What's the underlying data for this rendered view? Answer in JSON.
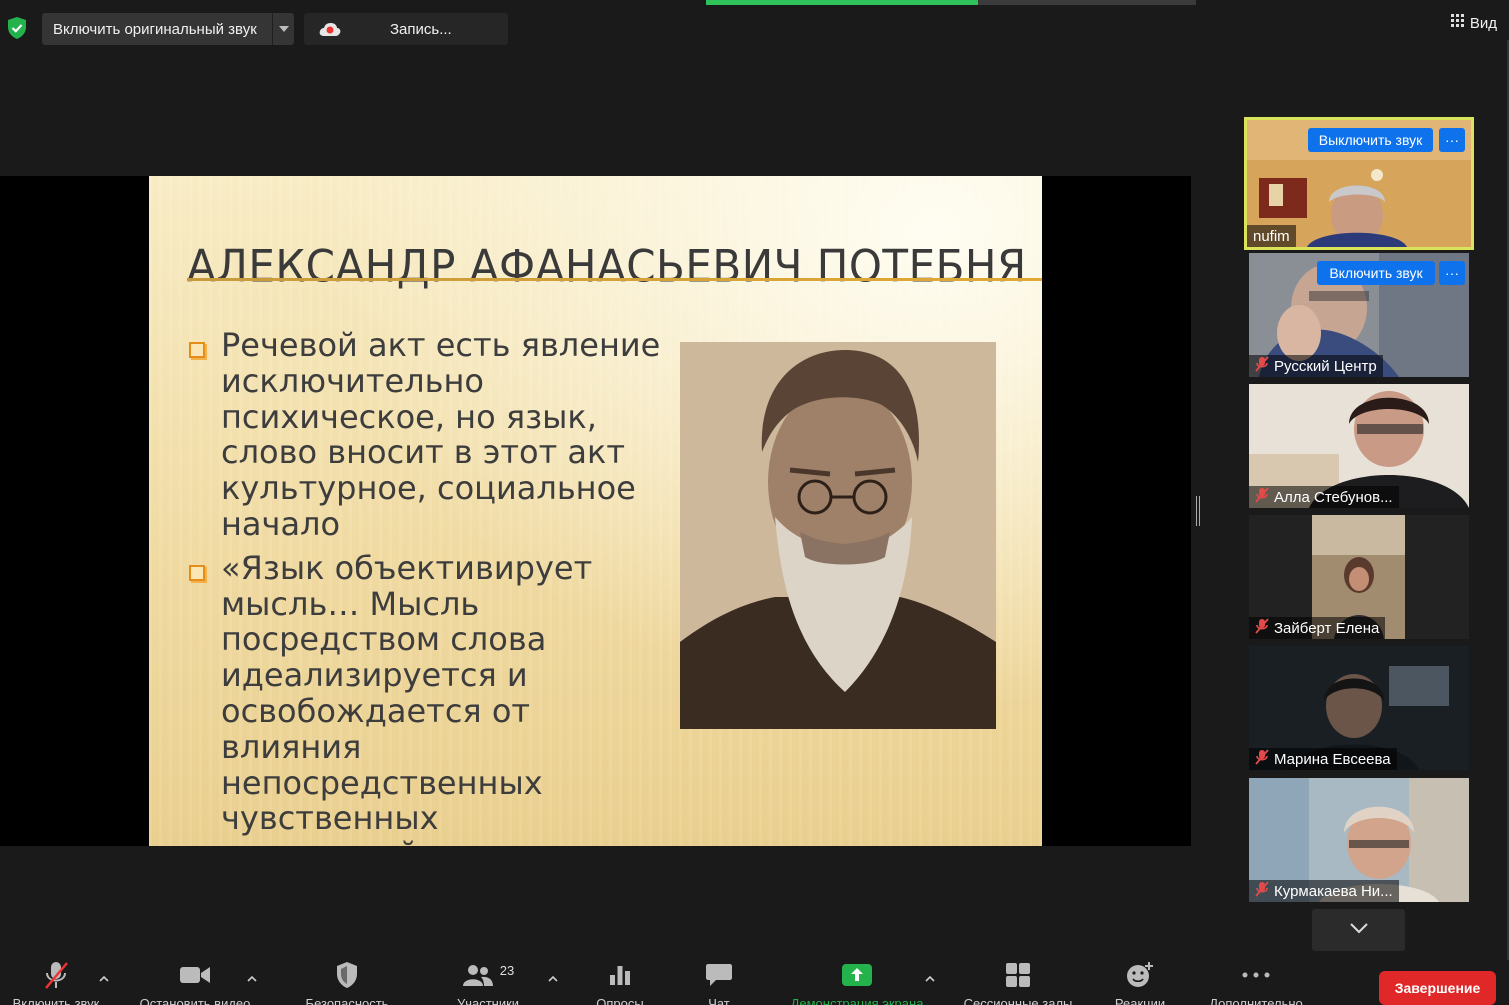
{
  "topbar": {
    "original_sound_label": "Включить оригинальный звук",
    "recording_label": "Запись...",
    "view_label": "Вид"
  },
  "slide": {
    "title": "АЛЕКСАНДР АФАНАСЬЕВИЧ ПОТЕБНЯ",
    "bullets": [
      "Речевой акт есть явление исключительно психическое, но язык, слово вносит в этот акт культурное, социальное начало",
      "«Язык объективирует мысль… Мысль посредством слова идеализируется и освобождается от влияния непосредственных чувственных восприятий…»"
    ]
  },
  "participants": [
    {
      "name": "nufim",
      "button": "Выключить звук",
      "more": "···"
    },
    {
      "name": "Русский Центр",
      "button": "Включить звук",
      "more": "···"
    },
    {
      "name": "Алла Стебунов..."
    },
    {
      "name": "Зайберт Елена"
    },
    {
      "name": "Марина Евсеева"
    },
    {
      "name": "Курмакаева Ни..."
    }
  ],
  "toolbar": {
    "mute_label": "Включить звук",
    "video_label": "Остановить видео",
    "security_label": "Безопасность",
    "participants_label": "Участники",
    "participants_count": "23",
    "polls_label": "Опросы",
    "chat_label": "Чат",
    "share_label": "Демонстрация экрана",
    "rooms_label": "Сессионные залы",
    "reactions_label": "Реакции",
    "more_label": "Дополнительно",
    "end_label": "Завершение"
  },
  "colors": {
    "accent_blue": "#0e72ed",
    "active_speaker": "#d9e45b",
    "share_green": "#2fc15a",
    "end_red": "#e02828"
  }
}
